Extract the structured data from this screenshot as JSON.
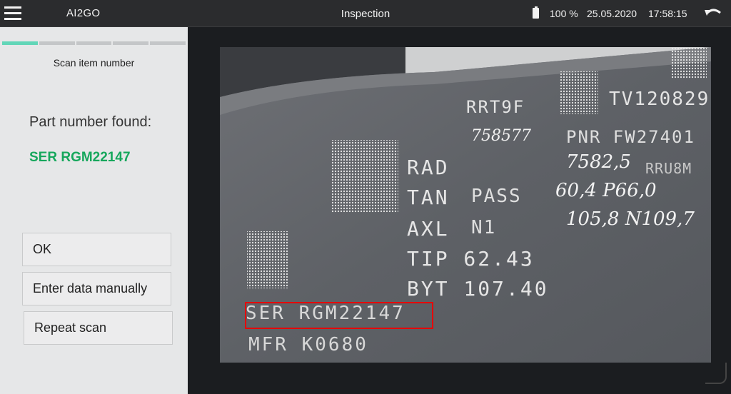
{
  "header": {
    "app_title": "AI2GO",
    "screen_title": "Inspection",
    "battery": "100 %",
    "date": "25.05.2020",
    "time": "17:58:15"
  },
  "progress": {
    "total_steps": 5,
    "current_step": 1
  },
  "left": {
    "step_label": "Scan item number",
    "found_label": "Part number found:",
    "found_value": "SER RGM22147",
    "buttons": {
      "ok": "OK",
      "manual": "Enter data manually",
      "repeat": "Repeat scan"
    }
  },
  "scan": {
    "lines": {
      "rrt": "RRT9F",
      "tv": "TV120829",
      "hand1": "758577",
      "pnr": "PNR FW27401",
      "rad": "RAD",
      "rad_hand": "7582,5",
      "rrubm": "RRU8M",
      "tan": "TAN",
      "tan_stamp": "PASS",
      "tan_hand": "60,4 P66,0",
      "axl": "AXL",
      "axl_stamp": "N1",
      "axl_hand": "105,8 N109,7",
      "tip": "TIP 62.43",
      "byt": "BYT 107.40",
      "ser": "SER RGM22147",
      "mfr": "MFR K0680"
    },
    "highlight_color": "#e60000"
  },
  "colors": {
    "accent": "#62d6b8",
    "found": "#16a75c",
    "topbar": "#2b2c2e"
  }
}
